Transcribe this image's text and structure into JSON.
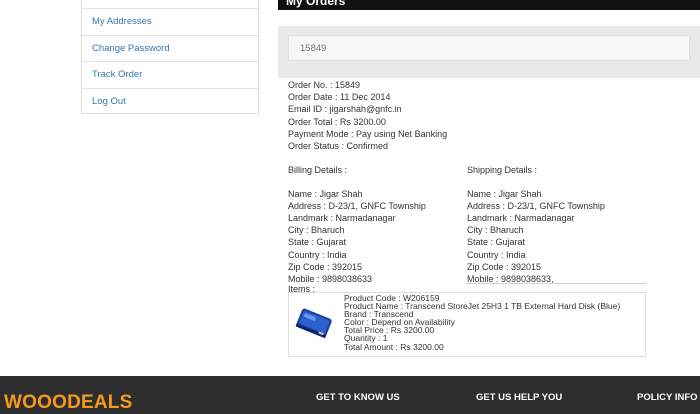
{
  "sidebar": {
    "items": [
      "",
      "My Addresses",
      "Change Password",
      "Track Order",
      "Log Out"
    ]
  },
  "main": {
    "title": "My Orders",
    "search_value": "15849"
  },
  "order": {
    "number": "Order No. : 15849",
    "date": "Order Date : 11 Dec 2014",
    "email": "Email ID : jigarshah@gnfc.in",
    "total": "Order Total : Rs 3200.00",
    "payment": "Payment Mode : Pay using Net Banking",
    "status": "Order Status : Confirmed"
  },
  "billing": {
    "heading": "Billing Details :",
    "name": "Name : Jigar Shah",
    "address": "Address : D-23/1, GNFC Township",
    "landmark": "Landmark : Narmadanagar",
    "city": "City : Bharuch",
    "state": "State : Gujarat",
    "country": "Country : India",
    "zip": "Zip Code : 392015",
    "mobile": "Mobile : 9898038633"
  },
  "shipping": {
    "heading": "Shipping Details :",
    "name": "Name : Jigar Shah",
    "address": "Address : D-23/1, GNFC Township",
    "landmark": "Landmark : Narmadanagar",
    "city": "City : Bharuch",
    "state": "State : Gujarat",
    "country": "Country : India",
    "zip": "Zip Code : 392015",
    "mobile": "Mobile : 9898038633,"
  },
  "items": {
    "label": "Items :",
    "product": {
      "code": "Product Code : W206159",
      "name": "Product Name : Transcend StoreJet 25H3 1 TB External Hard Disk (Blue)",
      "brand": "Brand : Transcend",
      "color": "Color : Depend on Availability",
      "price": "Total Price : Rs 3200.00",
      "quantity": "Quantity : 1",
      "amount": "Total Amount : Rs 3200.00",
      "image_icon": "hard-disk-icon"
    }
  },
  "footer": {
    "logo": "WOOODEALS",
    "col1": "GET TO KNOW US",
    "col2": "GET US HELP YOU",
    "col3": "POLICY INFO"
  },
  "colors": {
    "link": "#3277b0",
    "footer_bg": "#2e2e2e",
    "logo": "#f39c1f",
    "topbar": "#111111"
  }
}
